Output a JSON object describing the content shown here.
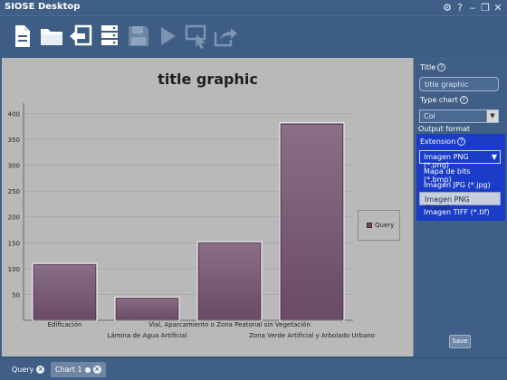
{
  "window": {
    "title": "SIOSE Desktop"
  },
  "titlebar_controls": [
    "gear-icon",
    "help-icon",
    "minimize-icon",
    "restore-icon",
    "close-icon"
  ],
  "toolbar": {
    "buttons": [
      {
        "name": "new-document-button",
        "icon": "document-icon"
      },
      {
        "name": "open-folder-button",
        "icon": "folder-icon"
      },
      {
        "name": "back-button",
        "icon": "back-arrow-icon"
      },
      {
        "name": "server-button",
        "icon": "server-icon"
      },
      {
        "name": "save-toolbar-button",
        "icon": "floppy-disk-icon"
      },
      {
        "name": "run-button",
        "icon": "play-icon"
      },
      {
        "name": "select-area-button",
        "icon": "select-icon"
      },
      {
        "name": "export-button",
        "icon": "share-arrow-icon"
      }
    ]
  },
  "chart_data": {
    "type": "bar",
    "title": "title graphic",
    "categories": [
      "Edificación",
      "Lámina de Agua Artificial",
      "Vial, Aparcamiento o Zona Peatonal sin Vegetación",
      "Zona Verde Artificial y Arbolado Urbano"
    ],
    "series": [
      {
        "name": "Query",
        "values": [
          110,
          45,
          152,
          382
        ]
      }
    ],
    "ylim": [
      0,
      420
    ],
    "yticks": [
      50,
      100,
      150,
      200,
      250,
      300,
      350,
      400
    ],
    "grid": true,
    "legend": "right",
    "bar_color": "#6a4a66"
  },
  "side_panel": {
    "title_label": "Title",
    "title_value": "title graphic",
    "type_chart_label": "Type chart",
    "type_chart_value": "Col",
    "output_format_label": "Output format",
    "extension_label": "Extension",
    "extension_value": "Imagen PNG (*.png)",
    "extension_options": [
      "Mapa de bits (*.bmp)",
      "Imagen JPG (*.jpg)",
      "Imagen PNG (*.png)",
      "Imagen TIFF (*.tif)"
    ],
    "selected_option": "Imagen PNG (*.png)",
    "save_label": "Save"
  },
  "tabs": [
    {
      "label": "Query",
      "active": false
    },
    {
      "label": "Chart 1",
      "active": true
    }
  ]
}
